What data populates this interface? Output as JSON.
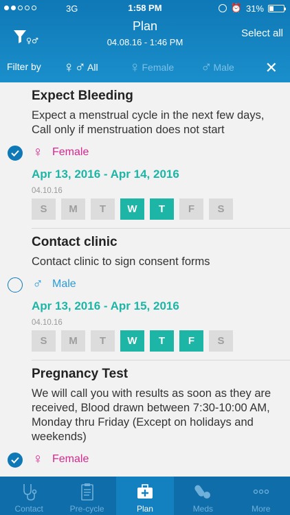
{
  "status": {
    "network": "3G",
    "time": "1:58 PM",
    "battery": "31%"
  },
  "nav": {
    "title": "Plan",
    "subtitle": "04.08.16 - 1:46 PM",
    "select_all": "Select all"
  },
  "filter": {
    "label": "Filter by",
    "options": [
      {
        "label": "All",
        "symbol": "♀♂",
        "active": true
      },
      {
        "label": "Female",
        "symbol": "♀",
        "active": false
      },
      {
        "label": "Male",
        "symbol": "♂",
        "active": false
      }
    ],
    "close": "✕"
  },
  "items": [
    {
      "title": "Expect Bleeding",
      "description": "Expect a menstrual cycle in the next few days, Call only if menstruation does not start",
      "gender": "Female",
      "gender_symbol": "♀",
      "checked": true,
      "dates": "Apr 13, 2016 - Apr 14, 2016",
      "posted": "04.10.16",
      "days": [
        {
          "label": "S",
          "on": false
        },
        {
          "label": "M",
          "on": false
        },
        {
          "label": "T",
          "on": false
        },
        {
          "label": "W",
          "on": true
        },
        {
          "label": "T",
          "on": true
        },
        {
          "label": "F",
          "on": false
        },
        {
          "label": "S",
          "on": false
        }
      ]
    },
    {
      "title": "Contact clinic",
      "description": "Contact clinic to sign consent forms",
      "gender": "Male",
      "gender_symbol": "♂",
      "checked": false,
      "dates": "Apr 13, 2016 - Apr 15, 2016",
      "posted": "04.10.16",
      "days": [
        {
          "label": "S",
          "on": false
        },
        {
          "label": "M",
          "on": false
        },
        {
          "label": "T",
          "on": false
        },
        {
          "label": "W",
          "on": true
        },
        {
          "label": "T",
          "on": true
        },
        {
          "label": "F",
          "on": true
        },
        {
          "label": "S",
          "on": false
        }
      ]
    },
    {
      "title": "Pregnancy Test",
      "description": "We will call you with results as soon as they are received, Blood drawn between 7:30-10:00 AM, Monday thru Friday (Except on holidays and weekends)",
      "gender": "Female",
      "gender_symbol": "♀",
      "checked": true
    }
  ],
  "tabs": [
    {
      "label": "Contact",
      "icon": "stethoscope-icon",
      "active": false
    },
    {
      "label": "Pre-cycle",
      "icon": "clipboard-icon",
      "active": false
    },
    {
      "label": "Plan",
      "icon": "medical-kit-icon",
      "active": true
    },
    {
      "label": "Meds",
      "icon": "pills-icon",
      "active": false
    },
    {
      "label": "More",
      "icon": "more-dots-icon",
      "active": false
    }
  ],
  "colors": {
    "header": "#0f78b6",
    "accent": "#1db5a6",
    "female": "#d6278e",
    "male": "#2a9bd6"
  }
}
